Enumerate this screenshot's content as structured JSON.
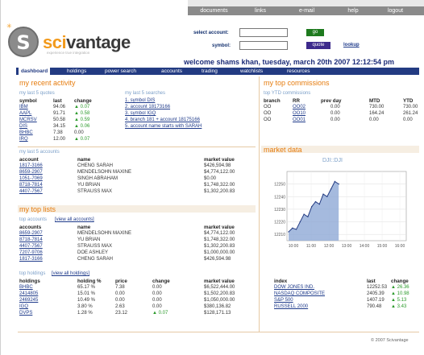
{
  "nav": [
    "documents",
    "links",
    "e-mail",
    "help",
    "logout"
  ],
  "brand": {
    "name_a": "sci",
    "name_b": "vantage",
    "tagline": "experience true integration",
    "logo_letter": "S"
  },
  "account_form": {
    "select_label": "select account:",
    "symbol_label": "symbol:",
    "go": "go",
    "quote": "quote",
    "lookup": "lookup"
  },
  "welcome": "welcome shams khan,  tuesday, march 20th 2007   12:12:54 pm",
  "menu": [
    "dashboard",
    "holdings",
    "power search",
    "accounts",
    "trading",
    "watchlists",
    "resources"
  ],
  "recent_activity": {
    "title": "my recent activity",
    "quotes_title": "my last 5 quotes",
    "quotes_headers": [
      "symbol",
      "last",
      "change"
    ],
    "quotes": [
      {
        "symbol": "IBM",
        "last": "94.06",
        "change": "▲ 0.07"
      },
      {
        "symbol": "AAPL",
        "last": "91.71",
        "change": "▲ 0.58"
      },
      {
        "symbol": "MCRSV",
        "last": "50.58",
        "change": "▲ 0.59"
      },
      {
        "symbol": "DIS",
        "last": "34.15",
        "change": "▲ 0.06"
      },
      {
        "symbol": "BHBC",
        "last": "7.38",
        "change": "0.00"
      },
      {
        "symbol": "IRQ",
        "last": "12.00",
        "change": "▲ 0.07"
      }
    ],
    "searches_title": "my last 5 searches",
    "searches": [
      "1. symbol DIS",
      "2. account 18173166",
      "3. symbol IGQ",
      "4. branch 181 + account 18175166",
      "5. account name starts with SARAH"
    ]
  },
  "last_accounts": {
    "title": "my last 5 accounts",
    "headers": [
      "account",
      "name",
      "market value"
    ],
    "rows": [
      {
        "account": "1817-3166",
        "name": "CHENG SARAH",
        "value": "$426,594.98"
      },
      {
        "account": "8659-2907",
        "name": "MENDELSOHN MAXINE",
        "value": "$4,774,122.00"
      },
      {
        "account": "1051-7069",
        "name": "SINGH ABRAHAM",
        "value": "$0.00"
      },
      {
        "account": "8718-7814",
        "name": "YU BRIAN",
        "value": "$1,748,322.00"
      },
      {
        "account": "4407-7567",
        "name": "STRAUSS MAX",
        "value": "$1,302,200.83"
      }
    ]
  },
  "top_lists": {
    "title": "my top lists",
    "top_accounts_title": "top accounts",
    "view_all_accounts": "[view all accounts]",
    "accounts_headers": [
      "accounts",
      "name",
      "market value"
    ],
    "accounts": [
      {
        "account": "8659-2907",
        "name": "MENDELSOHN MAXINE",
        "value": "$4,774,122.00"
      },
      {
        "account": "8718-7814",
        "name": "YU BRIAN",
        "value": "$1,748,322.00"
      },
      {
        "account": "4407-7567",
        "name": "STRAUSS MAX",
        "value": "$1,302,200.83"
      },
      {
        "account": "7207-9706",
        "name": "DOE ASHLEY",
        "value": "$1,000,000.00"
      },
      {
        "account": "1817-3166",
        "name": "CHENG SARAH",
        "value": "$426,594.98"
      }
    ],
    "top_holdings_title": "top holdings",
    "view_all_holdings": "[view all holdings]",
    "holdings_headers": [
      "holdings",
      "holding %",
      "price",
      "change",
      "market value"
    ],
    "holdings": [
      {
        "holding": "BHBC",
        "pct": "65.17 %",
        "price": "7.38",
        "change": "0.00",
        "value": "$6,522,444.00"
      },
      {
        "holding": "2414805",
        "pct": "15.01 %",
        "price": "0.00",
        "change": "0.00",
        "value": "$1,502,200.83"
      },
      {
        "holding": "2469245",
        "pct": "10.49 %",
        "price": "0.00",
        "change": "0.00",
        "value": "$1,050,000.00"
      },
      {
        "holding": "IGQ",
        "pct": "3.80 %",
        "price": "2.63",
        "change": "0.00",
        "value": "$380,136.82"
      },
      {
        "holding": "DVPS",
        "pct": "1.28 %",
        "price": "23.12",
        "change": "▲ 0.07",
        "value": "$128,171.13"
      }
    ]
  },
  "top_commissions": {
    "title": "my top commissions",
    "ytd_title": "top YTD commissions",
    "headers": [
      "branch",
      "RR",
      "prev day",
      "MTD",
      "YTD"
    ],
    "rows": [
      {
        "branch": "OO",
        "rr": "OO02",
        "prev": "0.00",
        "mtd": "730.00",
        "ytd": "730.00"
      },
      {
        "branch": "OO",
        "rr": "OO10",
        "prev": "0.00",
        "mtd": "164.24",
        "ytd": "261.24"
      },
      {
        "branch": "OO",
        "rr": "OO01",
        "prev": "0.00",
        "mtd": "0.00",
        "ytd": "0.00"
      }
    ]
  },
  "market_data": {
    "title": "market data",
    "chart_title": "DJI::DJI",
    "index_headers": [
      "index",
      "last",
      "change"
    ],
    "indices": [
      {
        "name": "DOW JONES IND.",
        "last": "12252.53",
        "change": "▲ 26.36"
      },
      {
        "name": "NASDAQ COMPOSITE",
        "last": "2405.39",
        "change": "▲ 10.98"
      },
      {
        "name": "S&P 500",
        "last": "1407.19",
        "change": "▲ 5.13"
      },
      {
        "name": "RUSSELL 2000",
        "last": "790.48",
        "change": "▲ 3.43"
      }
    ]
  },
  "chart_data": {
    "type": "area",
    "title": "DJI::DJI",
    "x_ticks": [
      "10:00",
      "11:00",
      "12:00",
      "13:00",
      "14:00",
      "15:00",
      "16:00"
    ],
    "y_ticks": [
      "12250",
      "12240",
      "12230",
      "12220",
      "12210"
    ],
    "ylim": [
      12205,
      12260
    ],
    "series": [
      {
        "values": [
          12212,
          12215,
          12214,
          12220,
          12226,
          12224,
          12232,
          12236,
          12234,
          12242,
          12240,
          12246,
          12252,
          12250
        ]
      }
    ],
    "grid": true,
    "color": "#8fa9d6"
  },
  "copyright": "© 2007 Scivantage"
}
